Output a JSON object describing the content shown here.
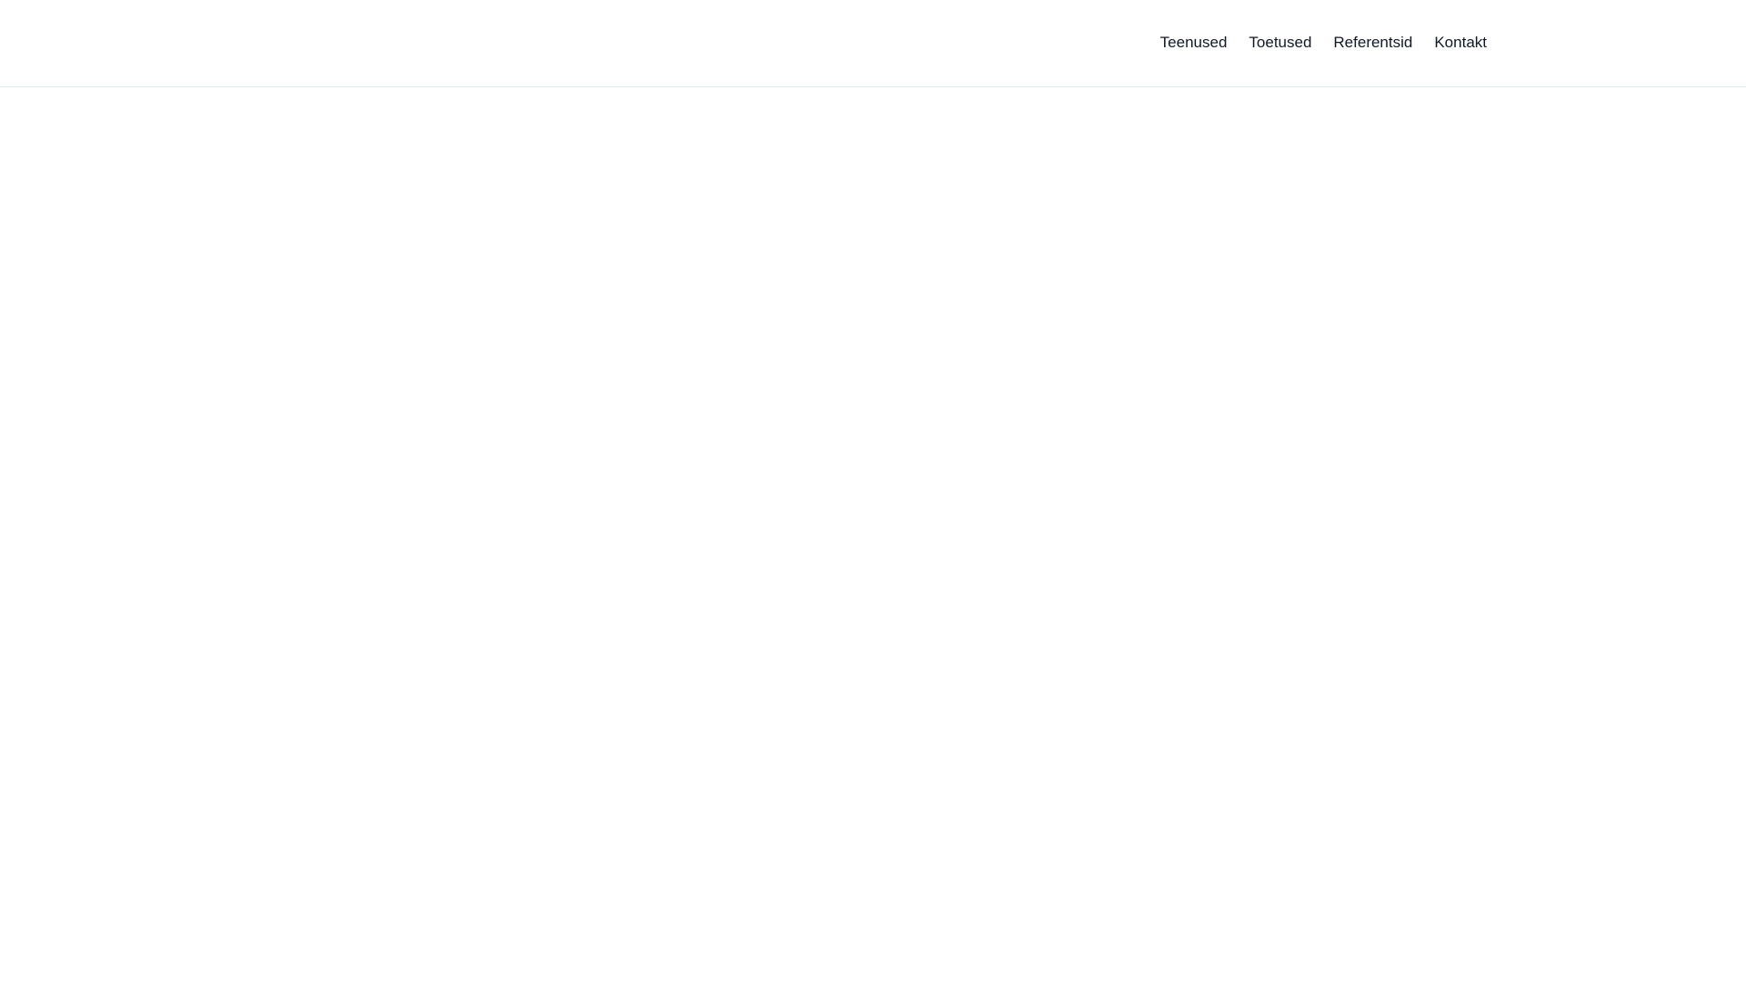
{
  "page": {
    "background_color": "#ffffff"
  },
  "header": {
    "border_color": "#e2e8f0",
    "link_color": "#111827",
    "nav_items": [
      {
        "label": "Teenused"
      },
      {
        "label": "Toetused"
      },
      {
        "label": "Referentsid"
      },
      {
        "label": "Kontakt"
      }
    ]
  }
}
